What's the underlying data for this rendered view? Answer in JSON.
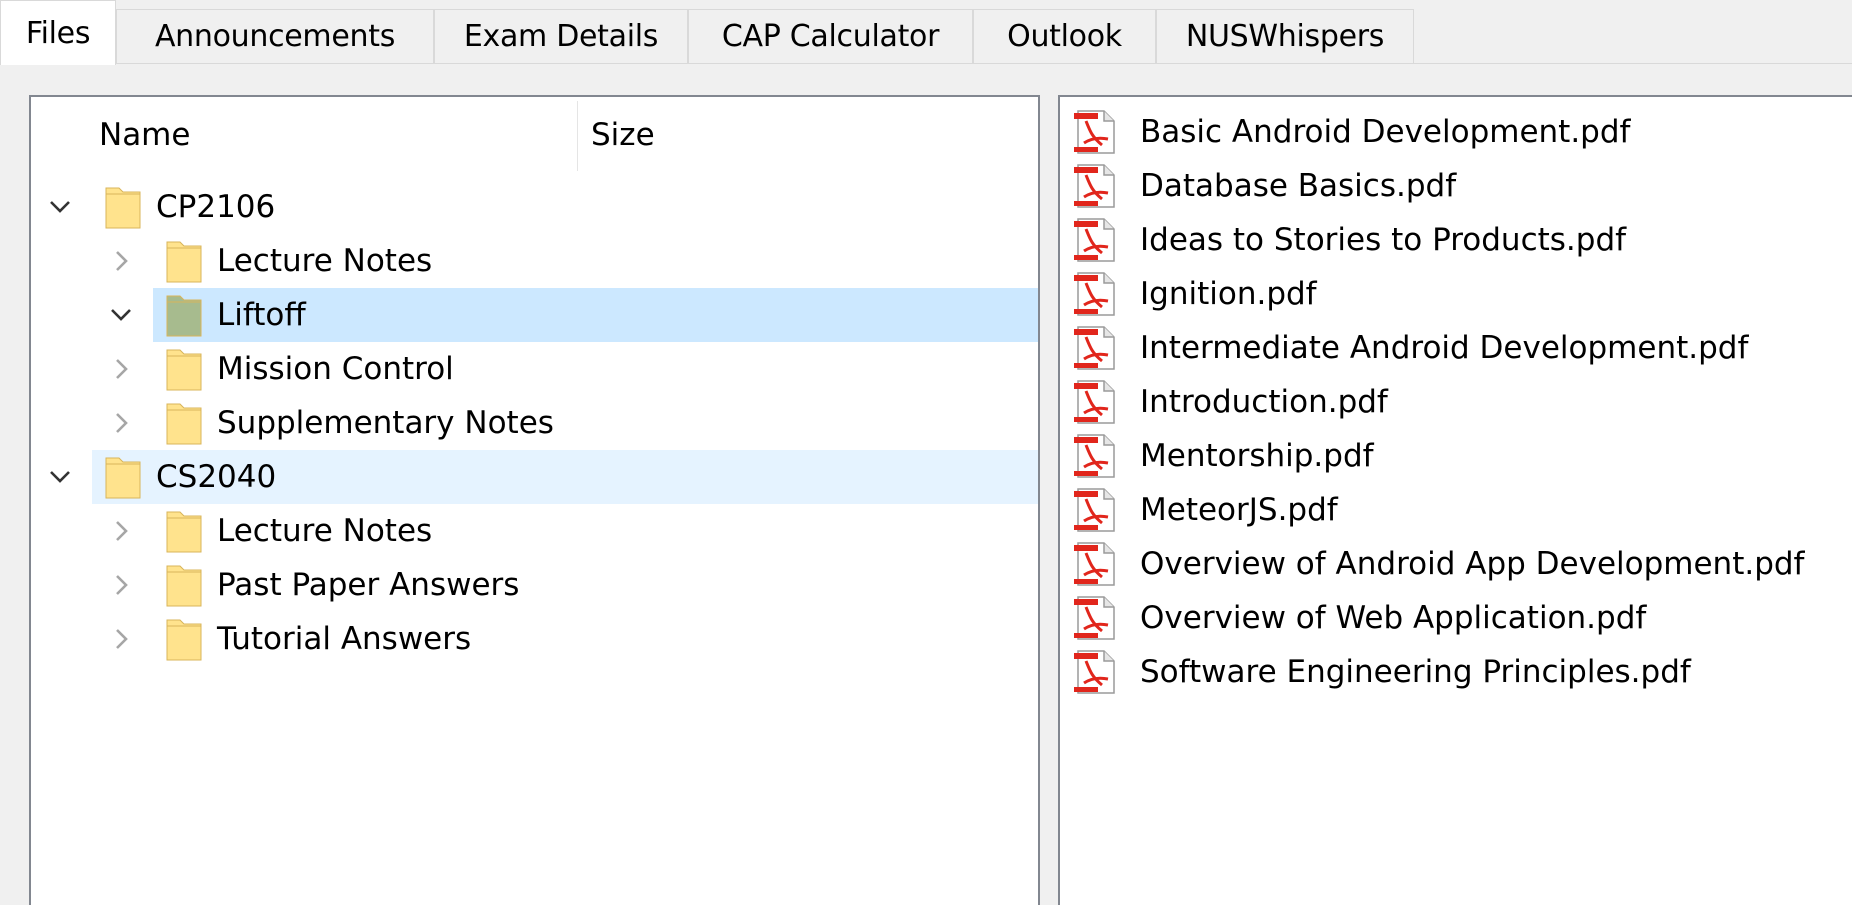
{
  "tabs": [
    {
      "label": "Files",
      "active": true
    },
    {
      "label": "Announcements",
      "active": false
    },
    {
      "label": "Exam Details",
      "active": false
    },
    {
      "label": "CAP Calculator",
      "active": false
    },
    {
      "label": "Outlook",
      "active": false
    },
    {
      "label": "NUSWhispers",
      "active": false
    }
  ],
  "tree": {
    "columns": {
      "name": "Name",
      "size": "Size"
    },
    "nodes": [
      {
        "label": "CP2106",
        "expanded": true,
        "level": 0,
        "state": "normal",
        "icon": "folder-icon"
      },
      {
        "label": "Lecture Notes",
        "expanded": false,
        "level": 1,
        "state": "normal",
        "icon": "folder-icon"
      },
      {
        "label": "Liftoff",
        "expanded": true,
        "level": 1,
        "state": "selected",
        "icon": "folder-open-icon"
      },
      {
        "label": "Mission Control",
        "expanded": false,
        "level": 1,
        "state": "normal",
        "icon": "folder-icon"
      },
      {
        "label": "Supplementary Notes",
        "expanded": false,
        "level": 1,
        "state": "normal",
        "icon": "folder-icon"
      },
      {
        "label": "CS2040",
        "expanded": true,
        "level": 0,
        "state": "hover",
        "icon": "folder-icon"
      },
      {
        "label": "Lecture Notes",
        "expanded": false,
        "level": 1,
        "state": "normal",
        "icon": "folder-icon"
      },
      {
        "label": "Past Paper Answers",
        "expanded": false,
        "level": 1,
        "state": "normal",
        "icon": "folder-icon"
      },
      {
        "label": "Tutorial Answers",
        "expanded": false,
        "level": 1,
        "state": "normal",
        "icon": "folder-icon"
      }
    ]
  },
  "files": [
    {
      "name": "Basic Android Development.pdf",
      "icon": "pdf-icon"
    },
    {
      "name": "Database Basics.pdf",
      "icon": "pdf-icon"
    },
    {
      "name": "Ideas to Stories to Products.pdf",
      "icon": "pdf-icon"
    },
    {
      "name": "Ignition.pdf",
      "icon": "pdf-icon"
    },
    {
      "name": "Intermediate Android Development.pdf",
      "icon": "pdf-icon"
    },
    {
      "name": "Introduction.pdf",
      "icon": "pdf-icon"
    },
    {
      "name": "Mentorship.pdf",
      "icon": "pdf-icon"
    },
    {
      "name": "MeteorJS.pdf",
      "icon": "pdf-icon"
    },
    {
      "name": "Overview of Android App Development.pdf",
      "icon": "pdf-icon"
    },
    {
      "name": "Overview of Web Application.pdf",
      "icon": "pdf-icon"
    },
    {
      "name": "Software Engineering Principles.pdf",
      "icon": "pdf-icon"
    }
  ],
  "colors": {
    "selected_row": "#cce8ff",
    "hover_row": "#e5f3ff",
    "folder": "#ffe38d",
    "folder_selected": "#a7bb8e",
    "pdf_red": "#e1261c"
  }
}
